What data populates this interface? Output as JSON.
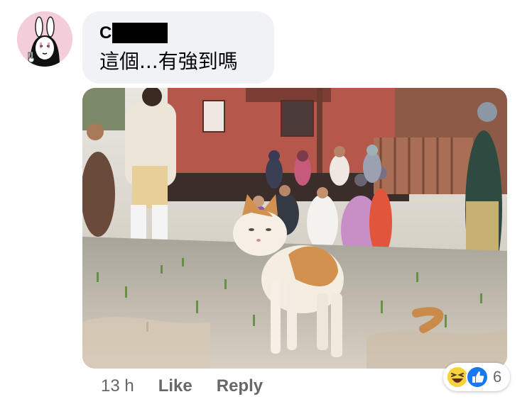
{
  "comment": {
    "author_visible": "C",
    "text": "這個...有強到嗎",
    "timestamp": "13 h",
    "like_label": "Like",
    "reply_label": "Reply"
  },
  "reactions": {
    "types": [
      "haha-icon",
      "like-icon"
    ],
    "count": "6"
  },
  "colors": {
    "bubble_bg": "#f0f2f5",
    "action_text": "#65676b",
    "like_blue": "#1877f2",
    "avatar_bg": "#f3cdd9"
  },
  "photo": {
    "subject": "cat"
  }
}
